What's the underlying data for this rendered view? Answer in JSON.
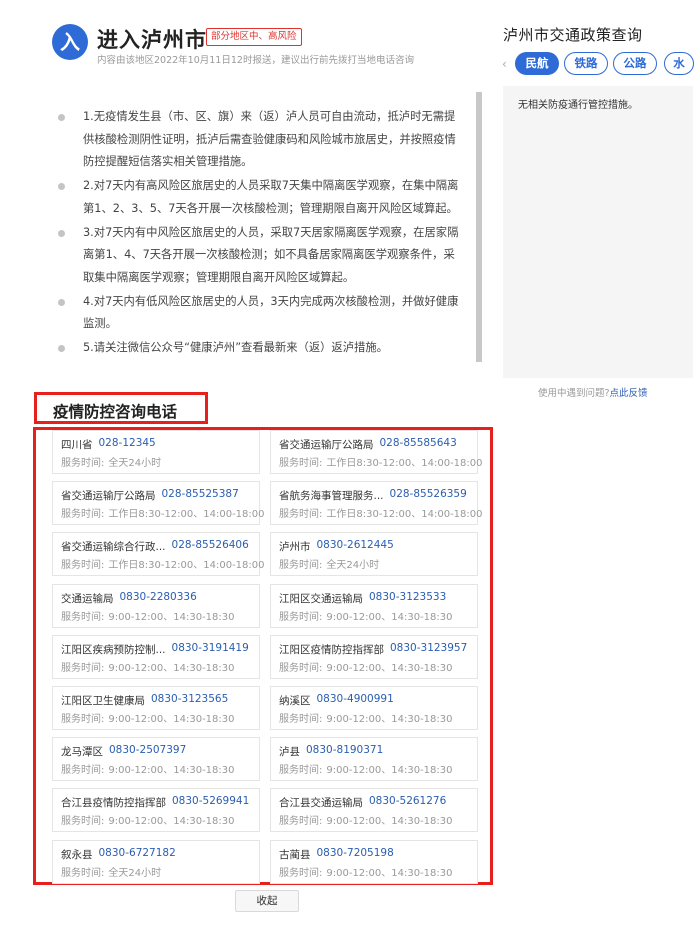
{
  "header": {
    "enter_icon": "入",
    "city": "进入泸州市",
    "risk_badge": "部分地区中、高风险",
    "subtitle": "内容由该地区2022年10月11日12时报送，建议出行前先拨打当地电话咨询"
  },
  "policies": [
    "1.无疫情发生县（市、区、旗）来（返）泸人员可自由流动，抵泸时无需提供核酸检测阴性证明，抵泸后需查验健康码和风险城市旅居史，并按照疫情防控提醒短信落实相关管理措施。",
    "2.对7天内有高风险区旅居史的人员采取7天集中隔离医学观察，在集中隔离第1、2、3、5、7天各开展一次核酸检测；管理期限自离开风险区域算起。",
    "3.对7天内有中风险区旅居史的人员，采取7天居家隔离医学观察，在居家隔离第1、4、7天各开展一次核酸检测；如不具备居家隔离医学观察条件，采取集中隔离医学观察；管理期限自离开风险区域算起。",
    "4.对7天内有低风险区旅居史的人员，3天内完成两次核酸检测，并做好健康监测。",
    "5.请关注微信公众号“健康泸州”查看最新来（返）返泸措施。"
  ],
  "consult": {
    "heading": "疫情防控咨询电话",
    "time_label": "服务时间:",
    "contacts": [
      {
        "org": "四川省",
        "phone": "028-12345",
        "hours": "全天24小时"
      },
      {
        "org": "省交通运输厅公路局",
        "phone": "028-85585643",
        "hours": "工作日8:30-12:00、14:00-18:00"
      },
      {
        "org": "省交通运输厅公路局",
        "phone": "028-85525387",
        "hours": "工作日8:30-12:00、14:00-18:00"
      },
      {
        "org": "省航务海事管理服务...",
        "phone": "028-85526359",
        "hours": "工作日8:30-12:00、14:00-18:00"
      },
      {
        "org": "省交通运输综合行政...",
        "phone": "028-85526406",
        "hours": "工作日8:30-12:00、14:00-18:00"
      },
      {
        "org": "泸州市",
        "phone": "0830-2612445",
        "hours": "全天24小时"
      },
      {
        "org": "交通运输局",
        "phone": "0830-2280336",
        "hours": "9:00-12:00、14:30-18:30"
      },
      {
        "org": "江阳区交通运输局",
        "phone": "0830-3123533",
        "hours": "9:00-12:00、14:30-18:30"
      },
      {
        "org": "江阳区疾病预防控制...",
        "phone": "0830-3191419",
        "hours": "9:00-12:00、14:30-18:30"
      },
      {
        "org": "江阳区疫情防控指挥部",
        "phone": "0830-3123957",
        "hours": "9:00-12:00、14:30-18:30"
      },
      {
        "org": "江阳区卫生健康局",
        "phone": "0830-3123565",
        "hours": "9:00-12:00、14:30-18:30"
      },
      {
        "org": "纳溪区",
        "phone": "0830-4900991",
        "hours": "9:00-12:00、14:30-18:30"
      },
      {
        "org": "龙马潭区",
        "phone": "0830-2507397",
        "hours": "9:00-12:00、14:30-18:30"
      },
      {
        "org": "泸县",
        "phone": "0830-8190371",
        "hours": "9:00-12:00、14:30-18:30"
      },
      {
        "org": "合江县疫情防控指挥部",
        "phone": "0830-5269941",
        "hours": "9:00-12:00、14:30-18:30"
      },
      {
        "org": "合江县交通运输局",
        "phone": "0830-5261276",
        "hours": "9:00-12:00、14:30-18:30"
      },
      {
        "org": "叙永县",
        "phone": "0830-6727182",
        "hours": "全天24小时"
      },
      {
        "org": "古蔺县",
        "phone": "0830-7205198",
        "hours": "9:00-12:00、14:30-18:30"
      }
    ],
    "collapse_label": "收起"
  },
  "side_panel": {
    "title": "泸州市交通政策查询",
    "prev_arrow": "‹",
    "tabs": [
      "民航",
      "铁路",
      "公路",
      "水"
    ],
    "active_tab": 0,
    "content": "无相关防疫通行管控措施。",
    "feedback_text": "使用中遇到问题?",
    "feedback_link": "点此反馈"
  },
  "colors": {
    "accent": "#2e6bd6",
    "highlight_border": "#e8201c",
    "phone_link": "#2a5db0",
    "risk": "#e0332e"
  }
}
